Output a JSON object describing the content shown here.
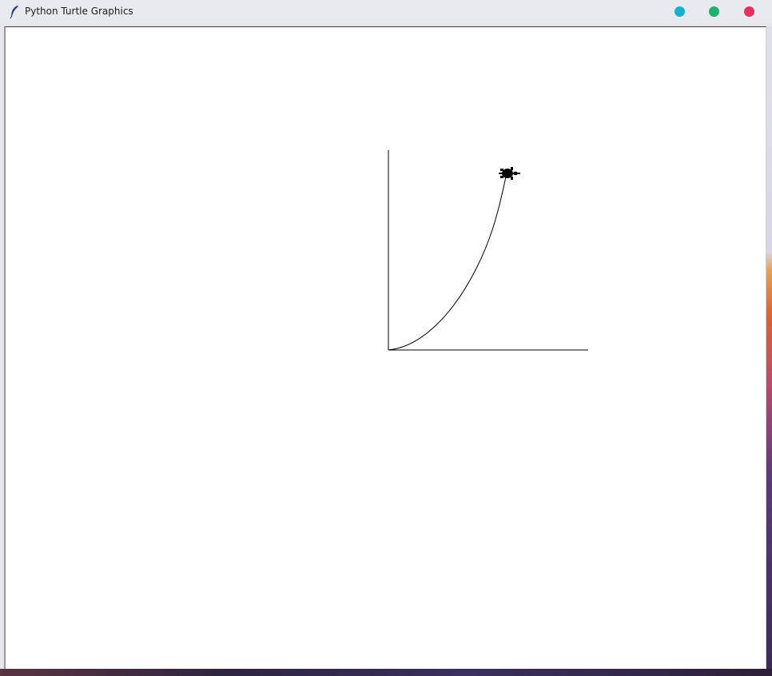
{
  "window": {
    "title": "Python Turtle Graphics",
    "controls": {
      "minimize_color": "#13b3d0",
      "maximize_color": "#1db36a",
      "close_color": "#e8305a"
    }
  },
  "canvas": {
    "background": "#ffffff",
    "drawing": {
      "description_items": [
        "y-axis-line",
        "x-axis-line",
        "parabola-curve",
        "turtle-cursor"
      ],
      "stroke_color": "#000000"
    },
    "icons": {
      "app": "feather-icon",
      "cursor": "turtle-icon"
    }
  }
}
